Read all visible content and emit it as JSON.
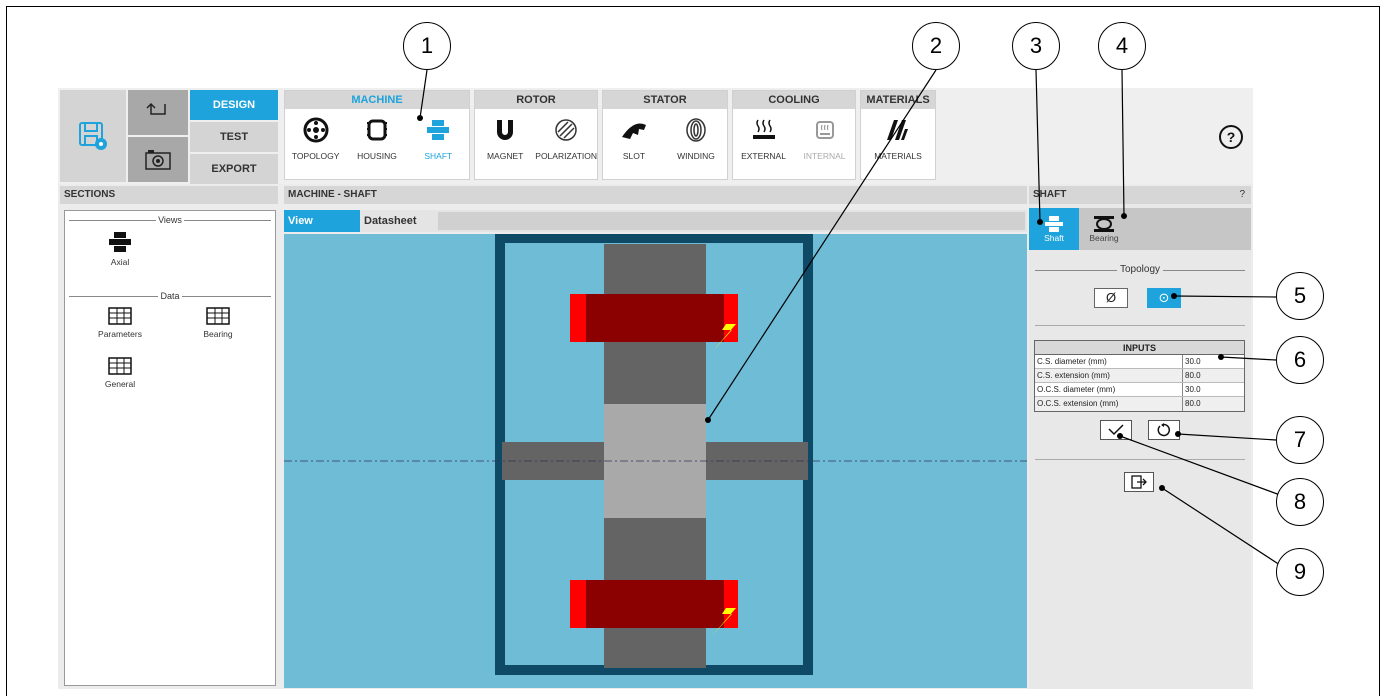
{
  "ribbon": {
    "modes": [
      "DESIGN",
      "TEST",
      "EXPORT"
    ],
    "active_mode": "DESIGN",
    "groups": [
      {
        "title": "MACHINE",
        "items": [
          "TOPOLOGY",
          "HOUSING",
          "SHAFT"
        ]
      },
      {
        "title": "ROTOR",
        "items": [
          "MAGNET",
          "POLARIZATION"
        ]
      },
      {
        "title": "STATOR",
        "items": [
          "SLOT",
          "WINDING"
        ]
      },
      {
        "title": "COOLING",
        "items": [
          "EXTERNAL",
          "INTERNAL"
        ]
      },
      {
        "title": "MATERIALS",
        "items": [
          "MATERIALS"
        ]
      }
    ],
    "help_symbol": "?"
  },
  "sections": {
    "title": "SECTIONS",
    "views_label": "Views",
    "data_label": "Data",
    "views": [
      "Axial"
    ],
    "data_items": [
      "Parameters",
      "Bearing",
      "General"
    ]
  },
  "main": {
    "title": "MACHINE - SHAFT",
    "tabs": [
      "View",
      "Datasheet"
    ],
    "active_tab": "View"
  },
  "shaft_panel": {
    "title": "SHAFT",
    "help": "?",
    "tabs": [
      "Shaft",
      "Bearing"
    ],
    "topology_label": "Topology",
    "topology_options": [
      "Ø",
      "⊙"
    ],
    "inputs_header": "INPUTS",
    "inputs": [
      {
        "label": "C.S. diameter (mm)",
        "value": "30.0"
      },
      {
        "label": "C.S. extension (mm)",
        "value": "80.0"
      },
      {
        "label": "O.C.S. diameter (mm)",
        "value": "30.0"
      },
      {
        "label": "O.C.S. extension (mm)",
        "value": "80.0"
      }
    ]
  },
  "callouts": [
    "1",
    "2",
    "3",
    "4",
    "5",
    "6",
    "7",
    "8",
    "9"
  ],
  "colors": {
    "accent": "#1ea3dc",
    "viewport": "#6fbcd6",
    "housing": "#0e4a66",
    "shaft": "#a9a9a9",
    "rotor_core": "#646464",
    "magnet": "#8b0000",
    "magnet_edge": "#ff0000",
    "bolt": "#ffff00"
  }
}
